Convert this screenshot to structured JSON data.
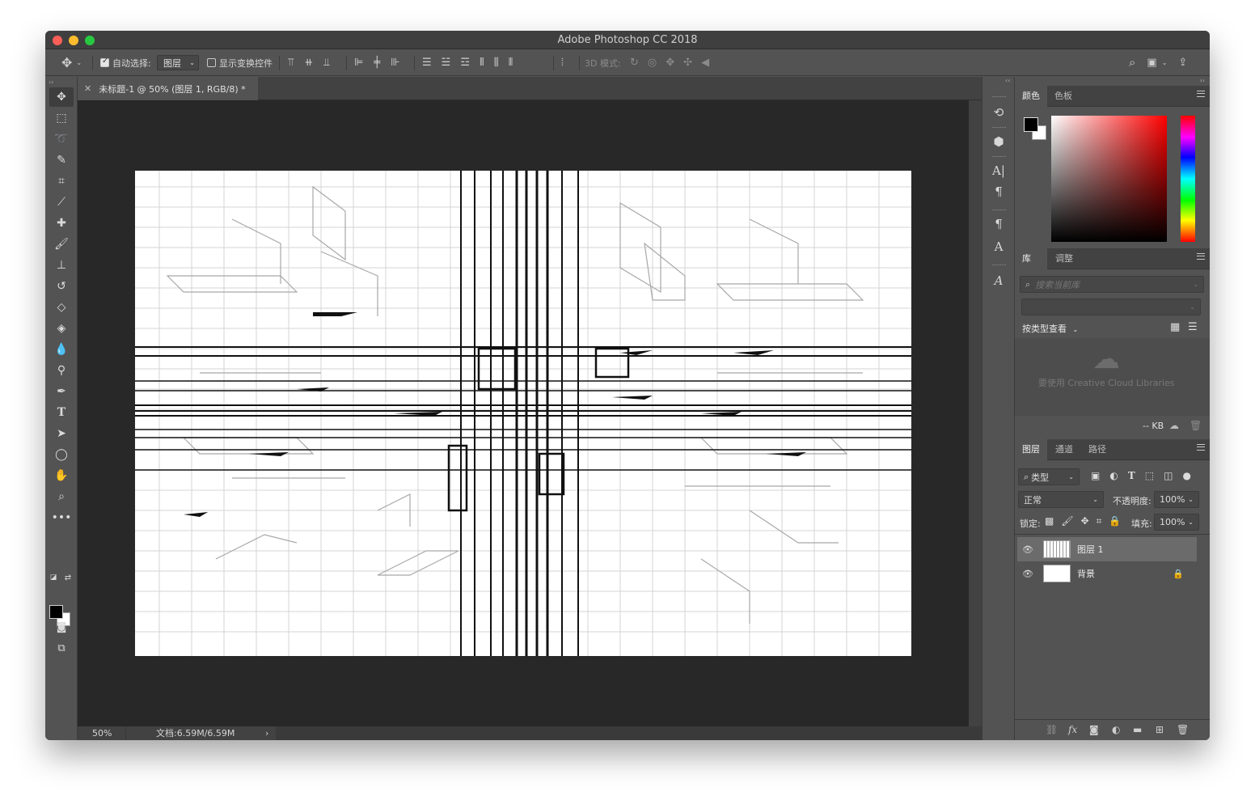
{
  "app": {
    "window_title": "Adobe Photoshop CC 2018"
  },
  "options_bar": {
    "auto_select_label": "自动选择:",
    "auto_select_checked": true,
    "auto_select_value": "图层",
    "show_transform_label": "显示变换控件",
    "show_transform_checked": false,
    "mode_3d_label": "3D 模式:"
  },
  "document": {
    "tab_title": "未标题-1 @ 50% (图层 1, RGB/8) *",
    "zoom": "50%",
    "doc_info": "文档:6.59M/6.59M"
  },
  "color_panel": {
    "tabs": [
      "颜色",
      "色板"
    ],
    "active_tab": "颜色",
    "foreground": "#000000",
    "background": "#ffffff"
  },
  "library_panel": {
    "tabs": [
      "库",
      "调整"
    ],
    "active_tab": "库",
    "search_placeholder": "搜索当前库",
    "view_by_label": "按类型查看",
    "cc_message": "要使用 Creative Cloud Libraries",
    "size_label": "-- KB"
  },
  "layers_panel": {
    "tabs": [
      "图层",
      "通道",
      "路径"
    ],
    "active_tab": "图层",
    "filter_label": "类型",
    "blend_mode": "正常",
    "opacity_label": "不透明度:",
    "opacity_value": "100%",
    "lock_label": "锁定:",
    "fill_label": "填充:",
    "fill_value": "100%",
    "layers": [
      {
        "name": "图层 1",
        "visible": true,
        "selected": true,
        "locked": false
      },
      {
        "name": "背景",
        "visible": true,
        "selected": false,
        "locked": true
      }
    ]
  },
  "icons": {
    "move_tool": "move-icon",
    "search": "search-icon",
    "share": "share-icon"
  }
}
